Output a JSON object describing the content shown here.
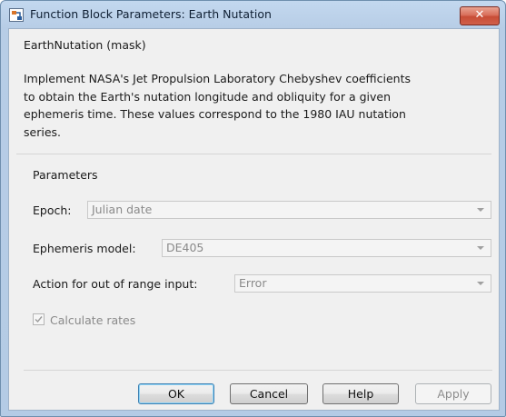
{
  "window": {
    "title": "Function Block Parameters: Earth Nutation",
    "close_label": "✕"
  },
  "mask": {
    "title": "EarthNutation (mask)",
    "description_lines": [
      "Implement NASA's Jet Propulsion Laboratory Chebyshev coefficients",
      "to obtain the Earth's nutation longitude and obliquity for a given",
      "ephemeris time. These values correspond to the 1980 IAU nutation",
      "series."
    ]
  },
  "parameters": {
    "title": "Parameters",
    "epoch": {
      "label": "Epoch:",
      "value": "Julian date"
    },
    "ephemeris": {
      "label": "Ephemeris model:",
      "value": "DE405"
    },
    "action": {
      "label": "Action for out of range input:",
      "value": "Error"
    },
    "calc_rates": {
      "label": "Calculate rates",
      "checked": true
    }
  },
  "buttons": {
    "ok": "OK",
    "cancel": "Cancel",
    "help": "Help",
    "apply": "Apply"
  },
  "colors": {
    "title_bar": "#b9cfe8",
    "close_button": "#c84d36",
    "default_button_border": "#3c7fb1",
    "disabled_text": "#8a8a8a"
  }
}
